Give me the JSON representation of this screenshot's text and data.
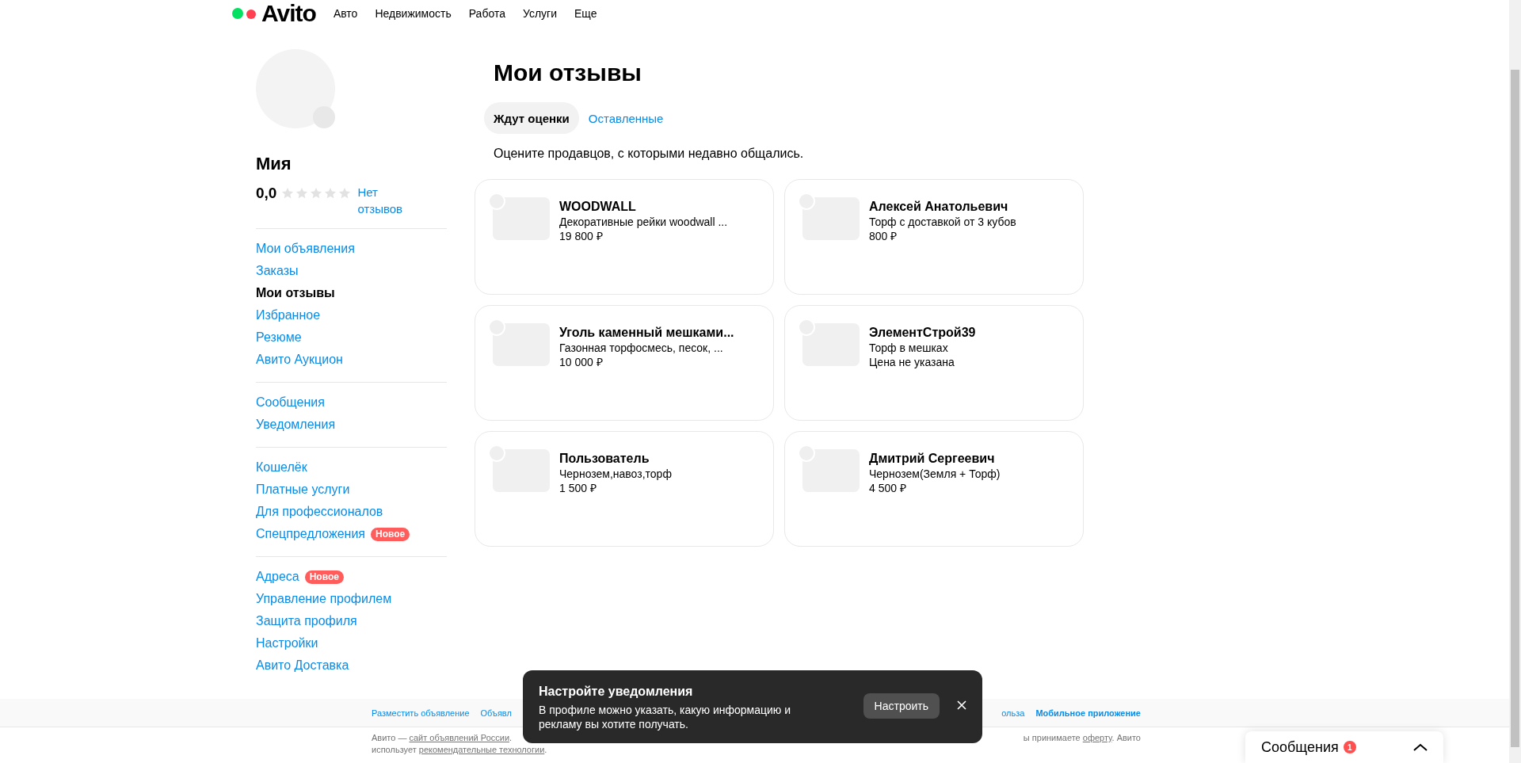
{
  "header": {
    "logo": "Avito",
    "nav": [
      "Авто",
      "Недвижимость",
      "Работа",
      "Услуги",
      "Еще"
    ]
  },
  "profile": {
    "name": "Мия",
    "rating": "0,0",
    "stars": 0,
    "reviews_link": "Нет отзывов"
  },
  "sidebar": {
    "sections": [
      {
        "items": [
          {
            "label": "Мои объявления",
            "selected": false
          },
          {
            "label": "Заказы",
            "selected": false
          },
          {
            "label": "Мои отзывы",
            "selected": true
          },
          {
            "label": "Избранное",
            "selected": false
          },
          {
            "label": "Резюме",
            "selected": false
          },
          {
            "label": "Авито Аукцион",
            "selected": false
          }
        ]
      },
      {
        "items": [
          {
            "label": "Сообщения",
            "selected": false
          },
          {
            "label": "Уведомления",
            "selected": false
          }
        ]
      },
      {
        "items": [
          {
            "label": "Кошелёк",
            "selected": false
          },
          {
            "label": "Платные услуги",
            "selected": false
          },
          {
            "label": "Для профессионалов",
            "selected": false
          },
          {
            "label": "Спецпредложения",
            "selected": false,
            "badge": "Новое"
          }
        ]
      },
      {
        "items": [
          {
            "label": "Адреса",
            "selected": false,
            "badge": "Новое"
          },
          {
            "label": "Управление профилем",
            "selected": false
          },
          {
            "label": "Защита профиля",
            "selected": false
          },
          {
            "label": "Настройки",
            "selected": false
          },
          {
            "label": "Авито Доставка",
            "selected": false
          }
        ]
      }
    ]
  },
  "page": {
    "title": "Мои отзывы",
    "tabs": [
      {
        "label": "Ждут оценки",
        "selected": true
      },
      {
        "label": "Оставленные",
        "selected": false
      }
    ],
    "description": "Оцените продавцов, с которыми недавно общались."
  },
  "cards": [
    {
      "title": "WOODWALL",
      "subtitle": "Декоративные рейки woodwall ...",
      "price": "19 800 ₽"
    },
    {
      "title": "Алексей Анатольевич",
      "subtitle": "Торф с доставкой от 3 кубов",
      "price": "800 ₽"
    },
    {
      "title": "Уголь каменный мешками...",
      "subtitle": "Газонная торфосмесь, песок, ...",
      "price": "10 000 ₽"
    },
    {
      "title": "ЭлементСтрой39",
      "subtitle": "Торф в мешках",
      "price": "Цена не указана"
    },
    {
      "title": "Пользователь",
      "subtitle": "Чернозем,навоз,торф",
      "price": "1 500 ₽"
    },
    {
      "title": "Дмитрий Сергеевич",
      "subtitle": "Чернозем(Земля + Торф)",
      "price": "4 500 ₽"
    }
  ],
  "footer": {
    "links_left": [
      {
        "text": "Разместить объявление",
        "bold": false
      },
      {
        "text": "Объявл",
        "bold": false
      }
    ],
    "links_right": [
      {
        "text": "ольза",
        "bold": false
      },
      {
        "text": "Мобильное приложение",
        "bold": true
      }
    ],
    "legal_line_1_left": [
      {
        "text": "Авито — ",
        "link": false
      },
      {
        "text": "сайт объявлений России",
        "link": true
      },
      {
        "text": ".",
        "link": false
      }
    ],
    "legal_line_1_right": [
      {
        "text": "ы принимаете ",
        "link": false
      },
      {
        "text": "оферту",
        "link": true
      },
      {
        "text": ". Авито",
        "link": false
      }
    ],
    "legal_line_2": [
      {
        "text": "использует ",
        "link": false
      },
      {
        "text": "рекомендательные технологии",
        "link": true
      },
      {
        "text": ".",
        "link": false
      }
    ]
  },
  "toast": {
    "title": "Настройте уведомления",
    "text": "В профиле можно указать, какую информацию и рекламу вы хотите получать.",
    "button": "Настроить"
  },
  "messages_widget": {
    "label": "Сообщения",
    "count": "1"
  }
}
